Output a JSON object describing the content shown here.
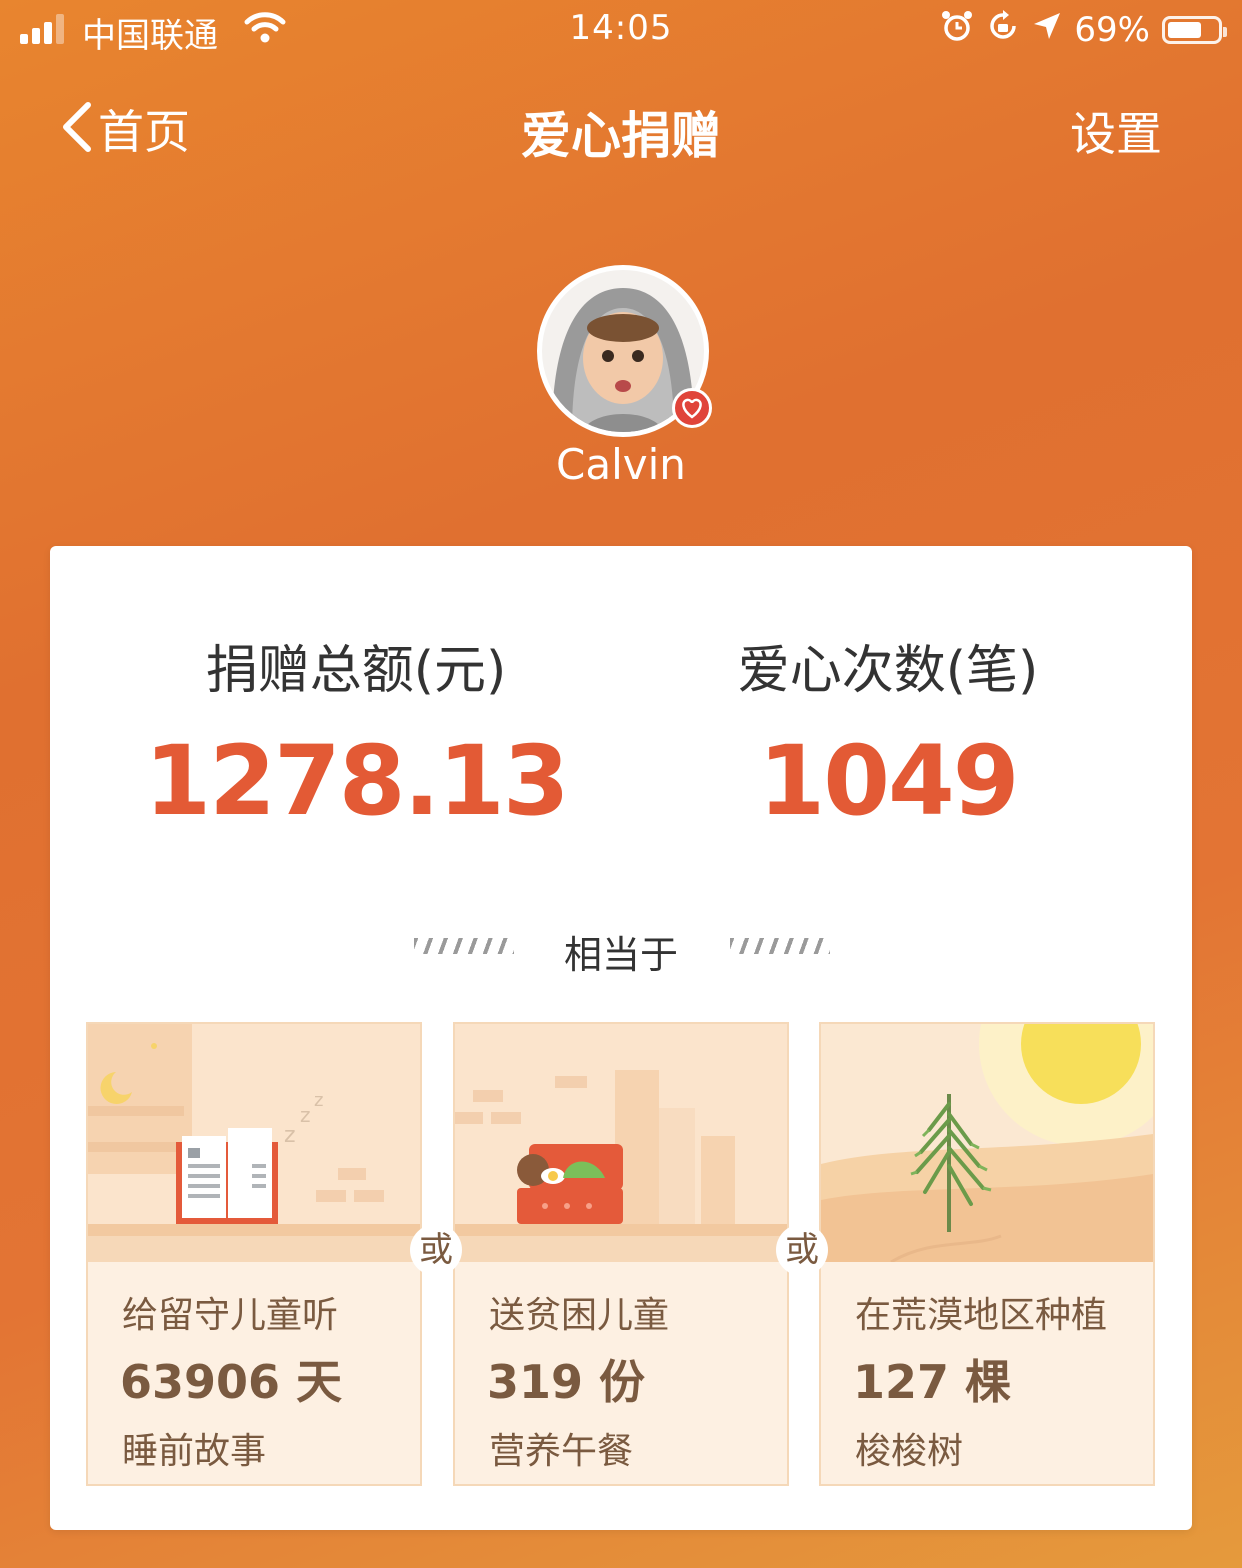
{
  "status_bar": {
    "carrier": "中国联通",
    "time": "14:05",
    "battery_percent": "69%",
    "battery_level": 0.69
  },
  "nav": {
    "back_label": "首页",
    "title": "爱心捐赠",
    "settings_label": "设置"
  },
  "profile": {
    "username": "Calvin",
    "badge_icon": "heart-badge-icon"
  },
  "stats": {
    "total_label": "捐赠总额(元)",
    "total_value": "1278.13",
    "count_label": "爱心次数(笔)",
    "count_value": "1049"
  },
  "equivalent_label": "相当于",
  "or_label": "或",
  "tiles": [
    {
      "line1": "给留守儿童听",
      "amount": "63906 天",
      "line3": "睡前故事",
      "icon": "bedtime-story-book-icon"
    },
    {
      "line1": "送贫困儿童",
      "amount": "319 份",
      "line3": "营养午餐",
      "icon": "lunch-box-icon"
    },
    {
      "line1": "在荒漠地区种植",
      "amount": "127 棵",
      "line3": "梭梭树",
      "icon": "desert-tree-icon"
    }
  ],
  "colors": {
    "accent": "#e35a35",
    "background_top": "#e07030",
    "tile_bg": "#fdf0e2",
    "tile_text": "#7a5a40"
  }
}
